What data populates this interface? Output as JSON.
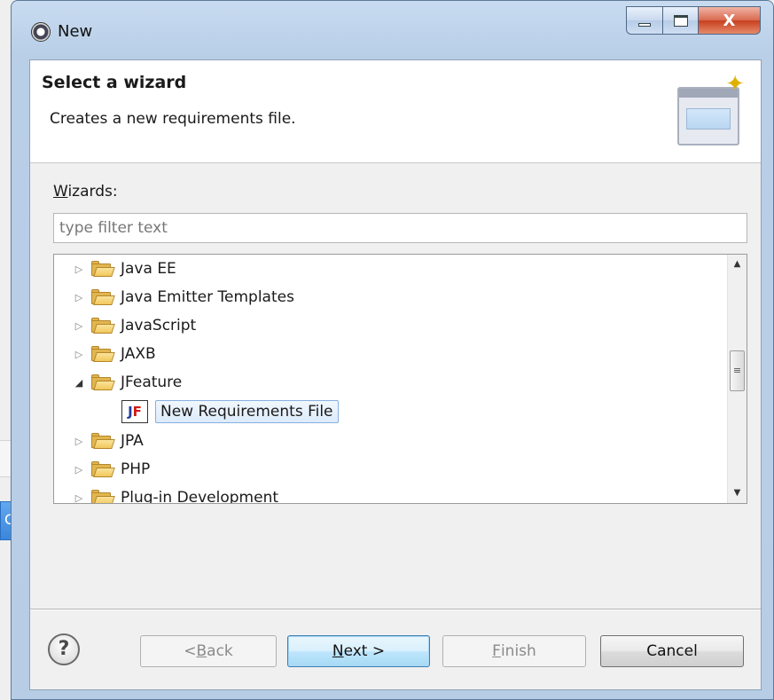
{
  "window": {
    "title": "New",
    "close_glyph": "X",
    "icon": "eclipse-gear-icon"
  },
  "header": {
    "title": "Select a wizard",
    "description": "Creates a new requirements file.",
    "banner_icon": "new-wizard-banner-icon"
  },
  "wizards": {
    "label_mnemonic": "W",
    "label_rest": "izards:",
    "filter_placeholder": "type filter text",
    "tree": [
      {
        "label": "Java EE",
        "expanded": false
      },
      {
        "label": "Java Emitter Templates",
        "expanded": false
      },
      {
        "label": "JavaScript",
        "expanded": false
      },
      {
        "label": "JAXB",
        "expanded": false
      },
      {
        "label": "JFeature",
        "expanded": true
      },
      {
        "label": "New Requirements File",
        "selected": true,
        "child": true,
        "icon_text_j": "J",
        "icon_text_f": "F"
      },
      {
        "label": "JPA",
        "expanded": false
      },
      {
        "label": "PHP",
        "expanded": false
      },
      {
        "label": "Plug-in Development",
        "expanded": false
      }
    ]
  },
  "buttons": {
    "help": "?",
    "back": {
      "prefix": "< ",
      "mnemonic": "B",
      "rest": "ack"
    },
    "next": {
      "mnemonic": "N",
      "rest": "ext >"
    },
    "finish": {
      "mnemonic": "F",
      "rest": "inish"
    },
    "cancel": "Cancel"
  },
  "background": {
    "fragment_text": "C"
  }
}
